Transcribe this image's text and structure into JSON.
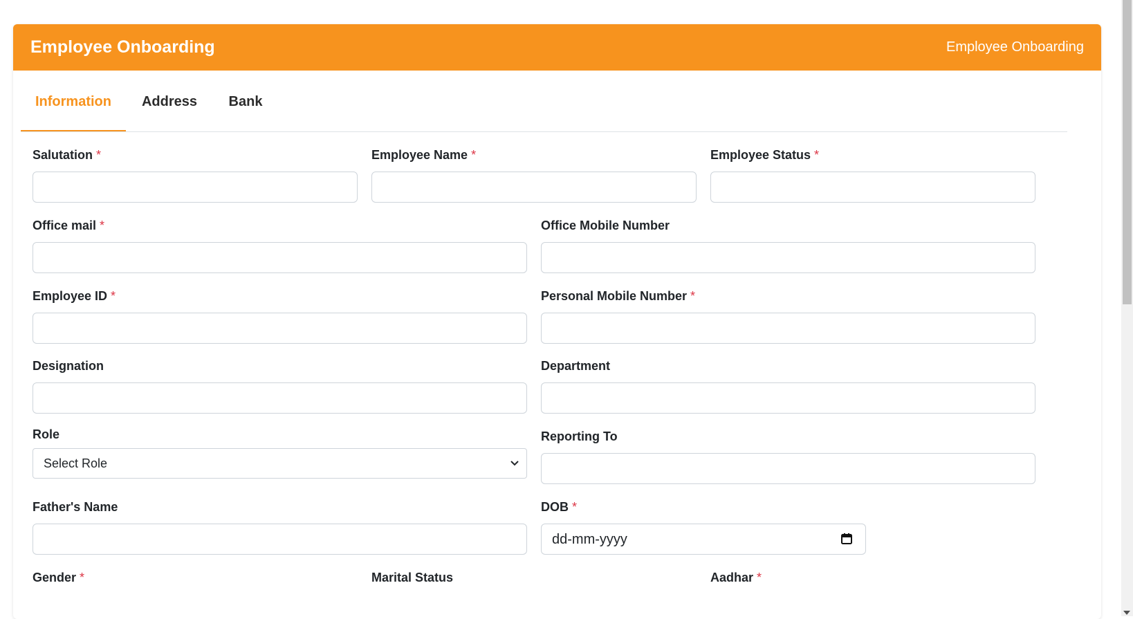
{
  "header": {
    "title": "Employee Onboarding",
    "breadcrumb": "Employee Onboarding"
  },
  "tabs": [
    {
      "label": "Information",
      "active": true
    },
    {
      "label": "Address",
      "active": false
    },
    {
      "label": "Bank",
      "active": false
    }
  ],
  "required_marker": "*",
  "form": {
    "salutation": {
      "label": "Salutation",
      "required": true,
      "value": ""
    },
    "employee_name": {
      "label": "Employee Name",
      "required": true,
      "value": ""
    },
    "employee_status": {
      "label": "Employee Status",
      "required": true,
      "value": ""
    },
    "office_mail": {
      "label": "Office mail",
      "required": true,
      "value": ""
    },
    "office_mobile": {
      "label": "Office Mobile Number",
      "required": false,
      "value": ""
    },
    "employee_id": {
      "label": "Employee ID",
      "required": true,
      "value": ""
    },
    "personal_mobile": {
      "label": "Personal Mobile Number",
      "required": true,
      "value": ""
    },
    "designation": {
      "label": "Designation",
      "required": false,
      "value": ""
    },
    "department": {
      "label": "Department",
      "required": false,
      "value": ""
    },
    "role": {
      "label": "Role",
      "required": false,
      "selected": "Select Role"
    },
    "reporting_to": {
      "label": "Reporting To",
      "required": false,
      "value": ""
    },
    "fathers_name": {
      "label": "Father's Name",
      "required": false,
      "value": ""
    },
    "dob": {
      "label": "DOB",
      "required": true,
      "placeholder": "dd-mm-yyyy"
    },
    "gender": {
      "label": "Gender",
      "required": true
    },
    "marital_status": {
      "label": "Marital Status",
      "required": false
    },
    "aadhar": {
      "label": "Aadhar",
      "required": true
    }
  },
  "colors": {
    "accent": "#f7931e",
    "required": "#dc3545",
    "border": "#ced4da"
  },
  "icons": {
    "role_select": "chevron-down-icon",
    "dob": "calendar-icon"
  }
}
